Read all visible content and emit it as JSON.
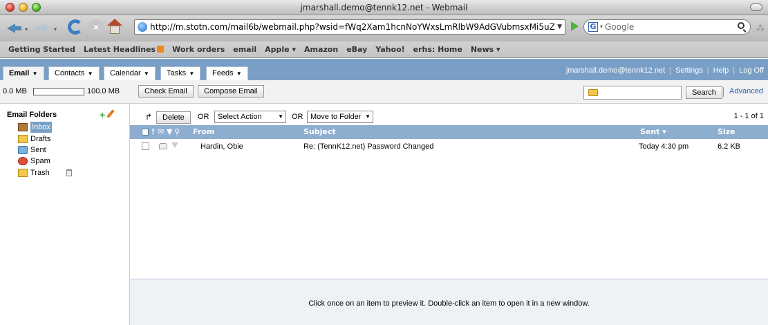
{
  "window": {
    "title": "jmarshall.demo@tennk12.net - Webmail"
  },
  "browser": {
    "url": "http://m.stotn.com/mail6b/webmail.php?wsid=fWq2Xam1hcnNoYWxsLmRlbW9AdGVubmsxMi5uZ",
    "search_placeholder": "Google",
    "search_engine_letter": "G"
  },
  "bookmarks": [
    "Getting Started",
    "Latest Headlines",
    "Work orders",
    "email",
    "Apple ▾",
    "Amazon",
    "eBay",
    "Yahoo!",
    "erhs: Home",
    "News ▾"
  ],
  "tabs": [
    {
      "label": "Email"
    },
    {
      "label": "Contacts"
    },
    {
      "label": "Calendar"
    },
    {
      "label": "Tasks"
    },
    {
      "label": "Feeds"
    }
  ],
  "user": {
    "email": "jmarshall.demo@tennk12.net",
    "settings": "Settings",
    "help": "Help",
    "logoff": "Log Off"
  },
  "quota": {
    "min": "0.0 MB",
    "max": "100.0 MB",
    "used_fraction": 0
  },
  "actions": {
    "check": "Check Email",
    "compose": "Compose Email",
    "search": "Search",
    "advanced": "Advanced"
  },
  "folders": {
    "heading": "Email Folders",
    "items": [
      {
        "label": "Inbox",
        "icon": "inbox-icon"
      },
      {
        "label": "Drafts",
        "icon": "drafts-folder-icon"
      },
      {
        "label": "Sent",
        "icon": "sent-icon"
      },
      {
        "label": "Spam",
        "icon": "spam-icon"
      },
      {
        "label": "Trash",
        "icon": "trash-folder-icon"
      }
    ]
  },
  "msgtoolbar": {
    "delete": "Delete",
    "or": "OR",
    "select_action": "Select Action",
    "move_to": "Move to Folder",
    "count": "1 - 1 of 1"
  },
  "table": {
    "headers": {
      "from": "From",
      "subject": "Subject",
      "sent": "Sent ▾",
      "size": "Size"
    },
    "rows": [
      {
        "from": "Hardin, Obie",
        "subject": "Re: (TennK12.net) Password Changed",
        "sent": "Today 4:30 pm",
        "size": "6.2 KB"
      }
    ]
  },
  "preview": {
    "hint": "Click once on an item to preview it. Double-click an item to open it in a new window."
  }
}
